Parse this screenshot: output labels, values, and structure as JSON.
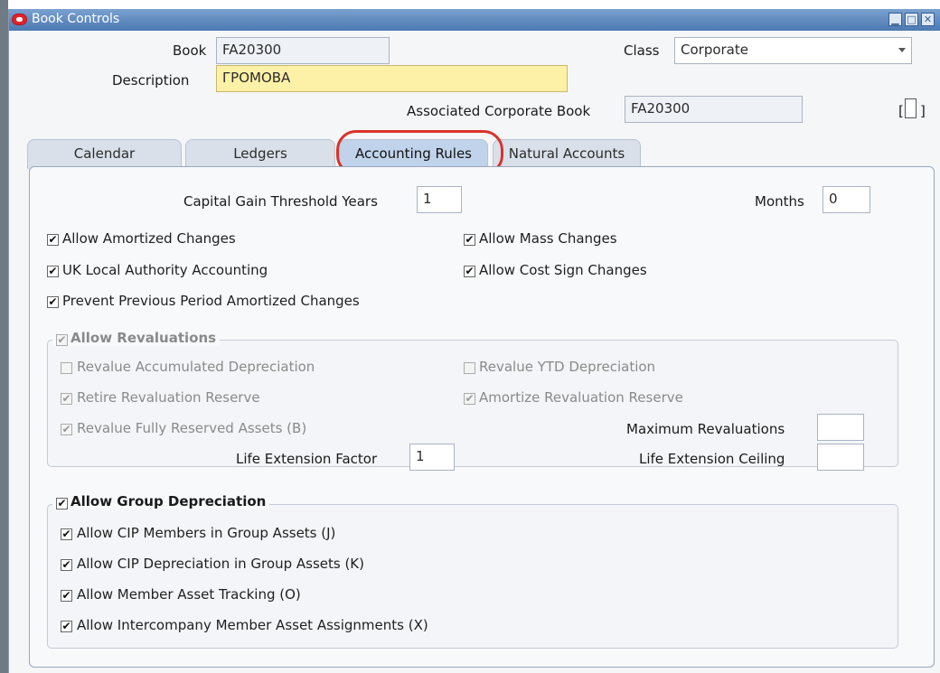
{
  "window": {
    "title": "Book Controls"
  },
  "header": {
    "book_label": "Book",
    "book_value": "FA20300",
    "class_label": "Class",
    "class_value": "Corporate",
    "description_label": "Description",
    "description_value": "ГРОМОВА",
    "assoc_label": "Associated Corporate Book",
    "assoc_value": "FA20300",
    "bracket_left": "[",
    "bracket_right": "]"
  },
  "tabs": [
    {
      "label": "Calendar"
    },
    {
      "label": "Ledgers"
    },
    {
      "label": "Accounting Rules"
    },
    {
      "label": "Natural Accounts"
    }
  ],
  "rules": {
    "capital_gain_label": "Capital Gain Threshold Years",
    "capital_gain_value": "1",
    "months_label": "Months",
    "months_value": "0",
    "allow_amortized": "Allow Amortized Changes",
    "allow_mass": "Allow Mass Changes",
    "uk_local": "UK Local Authority Accounting",
    "allow_cost_sign": "Allow Cost Sign Changes",
    "prevent_previous": "Prevent Previous Period Amortized Changes"
  },
  "revaluations": {
    "title": "Allow Revaluations",
    "revalue_accum": "Revalue Accumulated Depreciation",
    "revalue_ytd": "Revalue YTD Depreciation",
    "retire_reserve": "Retire Revaluation Reserve",
    "amortize_reserve": "Amortize Revaluation Reserve",
    "revalue_fully": "Revalue Fully Reserved Assets (B)",
    "max_reval_label": "Maximum Revaluations",
    "max_reval_value": "",
    "life_factor_label": "Life Extension Factor",
    "life_factor_value": "1",
    "life_ceiling_label": "Life Extension Ceiling",
    "life_ceiling_value": ""
  },
  "group_dep": {
    "title": "Allow Group Depreciation",
    "cip_members": "Allow CIP Members in Group Assets  (J)",
    "cip_depr": "Allow CIP Depreciation in Group Assets (K)",
    "member_tracking": "Allow Member Asset Tracking (O)",
    "intercompany": "Allow Intercompany Member Asset Assignments (X)"
  },
  "check_glyph": "✔",
  "colors": {
    "titlebar": "#4c79b2",
    "active_tab": "#c0d3ea",
    "highlight_ring": "#d8332b",
    "required_field": "#fdf1a7"
  }
}
